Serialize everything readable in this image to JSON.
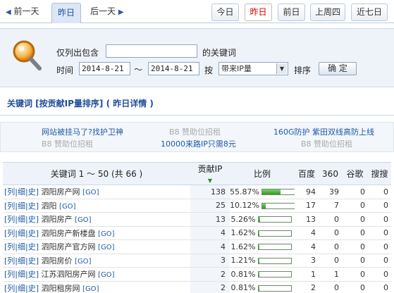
{
  "nav": {
    "prev_day": "前一天",
    "current_day": "昨日",
    "next_day": "后一天",
    "tabs": [
      {
        "label": "今日",
        "active": false
      },
      {
        "label": "昨日",
        "active": true
      },
      {
        "label": "前日",
        "active": false
      },
      {
        "label": "上周四",
        "active": false
      },
      {
        "label": "近七日",
        "active": false
      }
    ]
  },
  "search": {
    "only_contains_label": "仅列出包含",
    "keyword_suffix": "的关键词",
    "keyword_value": "",
    "time_label": "时间",
    "date_from": "2014-8-21",
    "date_sep": "～",
    "date_to": "2014-8-21",
    "by_label": "按",
    "sort_value": "带来IP量",
    "sort_label": "排序",
    "confirm_label": "确 定"
  },
  "heading": "关键词 [按贡献IP量排序] ( 昨日详情 )",
  "ads": {
    "a1": "网站被挂马了?找护卫神",
    "a2": "B8 赞助位招租",
    "a3": "160G防护 紫田双线高防上线",
    "a4": "B8 赞助位招租",
    "a5": "10000来路IP只需8元",
    "a6": "B8 赞助位招租"
  },
  "table": {
    "headers": {
      "keyword": "关键词 1 ～ 50 (共 66 )",
      "contrib": "贡献IP",
      "ratio": "比例",
      "baidu": "百度",
      "s360": "360",
      "google": "谷歌",
      "sogou": "搜搜"
    },
    "row_links": {
      "list": "列",
      "detail": "细",
      "history": "史",
      "go": "GO"
    },
    "rows": [
      {
        "keyword": "泗阳房产网",
        "ip": "138",
        "ratio": "55.87%",
        "ratio_value": 55.87,
        "baidu": "94",
        "s360": "39",
        "google": "0",
        "sogou": "0"
      },
      {
        "keyword": "泗阳",
        "ip": "25",
        "ratio": "10.12%",
        "ratio_value": 10.12,
        "baidu": "17",
        "s360": "7",
        "google": "0",
        "sogou": "0"
      },
      {
        "keyword": "泗阳房产",
        "ip": "13",
        "ratio": "5.26%",
        "ratio_value": 5.26,
        "baidu": "13",
        "s360": "0",
        "google": "0",
        "sogou": "0"
      },
      {
        "keyword": "泗阳房产新楼盘",
        "ip": "4",
        "ratio": "1.62%",
        "ratio_value": 1.62,
        "baidu": "4",
        "s360": "0",
        "google": "0",
        "sogou": "0"
      },
      {
        "keyword": "泗阳房产官方网",
        "ip": "4",
        "ratio": "1.62%",
        "ratio_value": 1.62,
        "baidu": "4",
        "s360": "0",
        "google": "0",
        "sogou": "0"
      },
      {
        "keyword": "泗阳房价",
        "ip": "3",
        "ratio": "1.21%",
        "ratio_value": 1.21,
        "baidu": "3",
        "s360": "0",
        "google": "0",
        "sogou": "0"
      },
      {
        "keyword": "江苏泗阳房产网",
        "ip": "2",
        "ratio": "0.81%",
        "ratio_value": 0.81,
        "baidu": "1",
        "s360": "1",
        "google": "0",
        "sogou": "0"
      },
      {
        "keyword": "泗阳租房网",
        "ip": "2",
        "ratio": "0.81%",
        "ratio_value": 0.81,
        "baidu": "2",
        "s360": "0",
        "google": "0",
        "sogou": "0"
      }
    ]
  },
  "colors": {
    "accent": "#1f4e9a",
    "active_tab": "#d40000",
    "bar_fill": "#2f9a24"
  }
}
